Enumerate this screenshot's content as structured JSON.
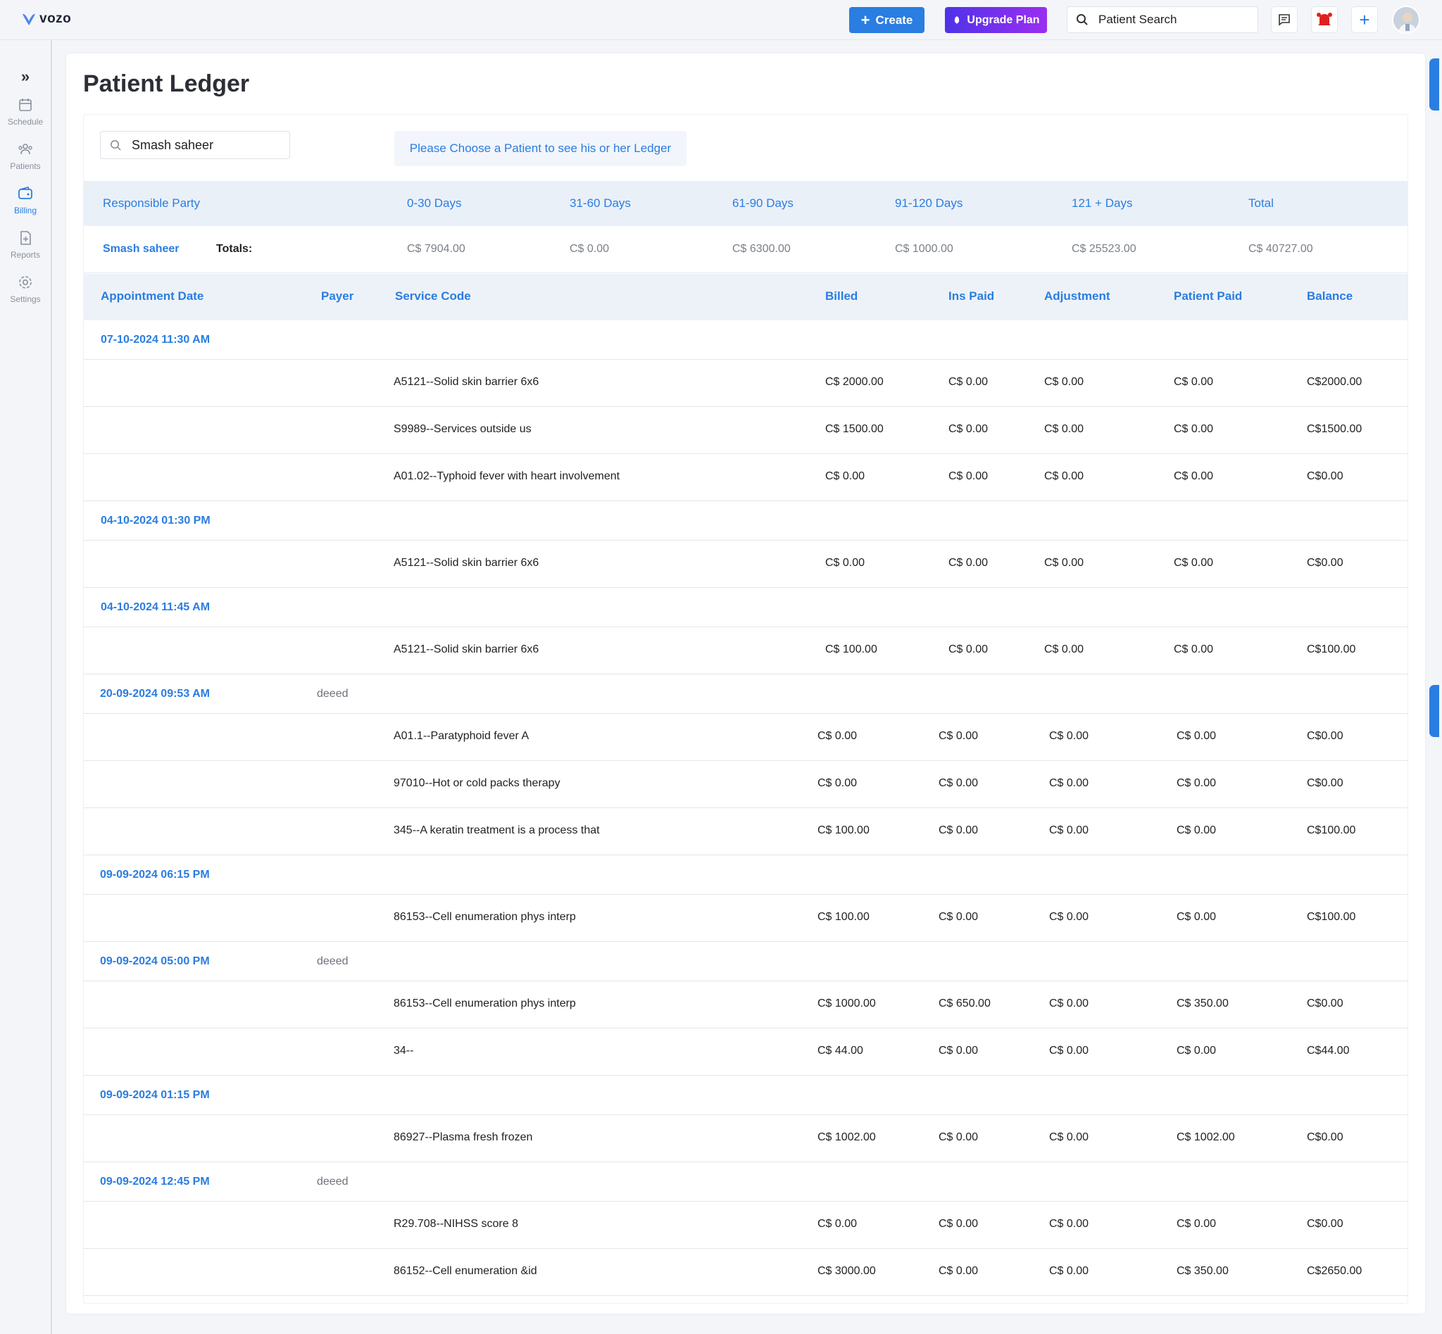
{
  "header": {
    "logo_text": "vozo",
    "create_label": "Create",
    "upgrade_label": "Upgrade Plan",
    "search_placeholder": "Patient Search",
    "accent": "#2a7de1",
    "upgrade_gradient": [
      "#4f32e8",
      "#9a2ff0"
    ]
  },
  "sidebar": {
    "items": [
      {
        "label": "Schedule",
        "icon": "calendar-icon",
        "active": false
      },
      {
        "label": "Patients",
        "icon": "users-icon",
        "active": false
      },
      {
        "label": "Billing",
        "icon": "wallet-icon",
        "active": true
      },
      {
        "label": "Reports",
        "icon": "report-icon",
        "active": false
      },
      {
        "label": "Settings",
        "icon": "gear-icon",
        "active": false
      }
    ]
  },
  "page": {
    "title": "Patient Ledger",
    "patient_search_value": "Smash saheer",
    "choose_message": "Please Choose a Patient to see his or her Ledger"
  },
  "aging": {
    "headers": [
      "Responsible Party",
      "0-30 Days",
      "31-60 Days",
      "61-90 Days",
      "91-120 Days",
      "121 + Days",
      "Total"
    ],
    "party": "Smash saheer",
    "totals_label": "Totals:",
    "values": [
      "C$ 7904.00",
      "C$ 0.00",
      "C$ 6300.00",
      "C$ 1000.00",
      "C$ 25523.00",
      "C$ 40727.00"
    ]
  },
  "ledger": {
    "headers": [
      "Appointment Date",
      "Payer",
      "Service Code",
      "Billed",
      "Ins Paid",
      "Adjustment",
      "Patient Paid",
      "Balance"
    ],
    "groups": [
      {
        "date": "07-10-2024 11:30 AM",
        "payer": "",
        "items": [
          {
            "code": "A5121--Solid skin barrier 6x6",
            "billed": "C$ 2000.00",
            "ins": "C$ 0.00",
            "adj": "C$ 0.00",
            "pp": "C$ 0.00",
            "bal": "C$2000.00"
          },
          {
            "code": "S9989--Services outside us",
            "billed": "C$ 1500.00",
            "ins": "C$ 0.00",
            "adj": "C$ 0.00",
            "pp": "C$ 0.00",
            "bal": "C$1500.00"
          },
          {
            "code": "A01.02--Typhoid fever with heart involvement",
            "billed": "C$ 0.00",
            "ins": "C$ 0.00",
            "adj": "C$ 0.00",
            "pp": "C$ 0.00",
            "bal": "C$0.00"
          }
        ]
      },
      {
        "date": "04-10-2024 01:30 PM",
        "payer": "",
        "items": [
          {
            "code": "A5121--Solid skin barrier 6x6",
            "billed": "C$ 0.00",
            "ins": "C$ 0.00",
            "adj": "C$ 0.00",
            "pp": "C$ 0.00",
            "bal": "C$0.00"
          }
        ]
      },
      {
        "date": "04-10-2024 11:45 AM",
        "payer": "",
        "items": [
          {
            "code": "A5121--Solid skin barrier 6x6",
            "billed": "C$ 100.00",
            "ins": "C$ 0.00",
            "adj": "C$ 0.00",
            "pp": "C$ 0.00",
            "bal": "C$100.00"
          }
        ]
      },
      {
        "date": "20-09-2024 09:53 AM",
        "payer": "deeed",
        "items": [
          {
            "code": "A01.1--Paratyphoid fever A",
            "billed": "C$ 0.00",
            "ins": "C$ 0.00",
            "adj": "C$ 0.00",
            "pp": "C$ 0.00",
            "bal": "C$0.00"
          },
          {
            "code": "97010--Hot or cold packs therapy",
            "billed": "C$ 0.00",
            "ins": "C$ 0.00",
            "adj": "C$ 0.00",
            "pp": "C$ 0.00",
            "bal": "C$0.00"
          },
          {
            "code": "345--A keratin treatment is a process that",
            "billed": "C$ 100.00",
            "ins": "C$ 0.00",
            "adj": "C$ 0.00",
            "pp": "C$ 0.00",
            "bal": "C$100.00"
          }
        ]
      },
      {
        "date": "09-09-2024 06:15 PM",
        "payer": "",
        "items": [
          {
            "code": "86153--Cell enumeration phys interp",
            "billed": "C$ 100.00",
            "ins": "C$ 0.00",
            "adj": "C$ 0.00",
            "pp": "C$ 0.00",
            "bal": "C$100.00"
          }
        ]
      },
      {
        "date": "09-09-2024 05:00 PM",
        "payer": "deeed",
        "items": [
          {
            "code": "86153--Cell enumeration phys interp",
            "billed": "C$ 1000.00",
            "ins": "C$ 650.00",
            "adj": "C$ 0.00",
            "pp": "C$ 350.00",
            "bal": "C$0.00"
          },
          {
            "code": "34--",
            "billed": "C$ 44.00",
            "ins": "C$ 0.00",
            "adj": "C$ 0.00",
            "pp": "C$ 0.00",
            "bal": "C$44.00"
          }
        ]
      },
      {
        "date": "09-09-2024 01:15 PM",
        "payer": "",
        "items": [
          {
            "code": "86927--Plasma fresh frozen",
            "billed": "C$ 1002.00",
            "ins": "C$ 0.00",
            "adj": "C$ 0.00",
            "pp": "C$ 1002.00",
            "bal": "C$0.00"
          }
        ]
      },
      {
        "date": "09-09-2024 12:45 PM",
        "payer": "deeed",
        "items": [
          {
            "code": "R29.708--NIHSS score 8",
            "billed": "C$ 0.00",
            "ins": "C$ 0.00",
            "adj": "C$ 0.00",
            "pp": "C$ 0.00",
            "bal": "C$0.00"
          },
          {
            "code": "86152--Cell enumeration &id",
            "billed": "C$ 3000.00",
            "ins": "C$ 0.00",
            "adj": "C$ 0.00",
            "pp": "C$ 350.00",
            "bal": "C$2650.00"
          }
        ]
      }
    ]
  }
}
